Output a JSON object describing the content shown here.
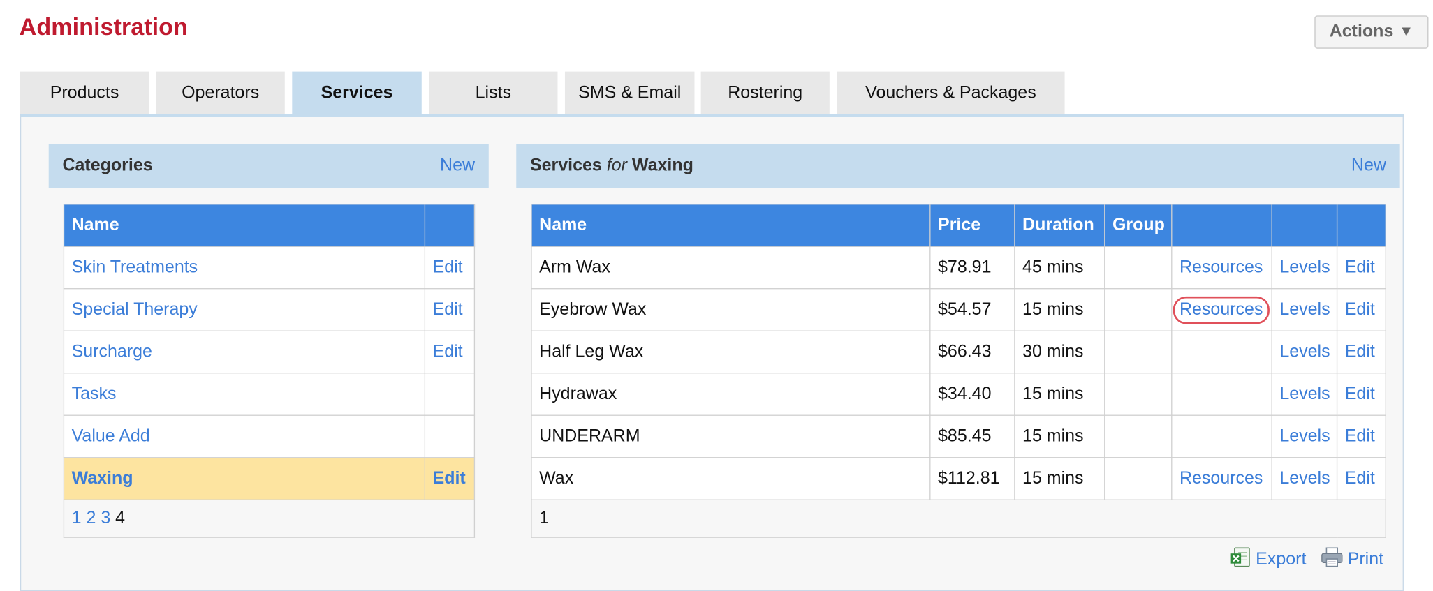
{
  "page_title": "Administration",
  "actions": {
    "label": "Actions",
    "arrow": "▼"
  },
  "tabs": [
    {
      "label": "Products",
      "active": false
    },
    {
      "label": "Operators",
      "active": false
    },
    {
      "label": "Services",
      "active": true
    },
    {
      "label": "Lists",
      "active": false
    },
    {
      "label": "SMS & Email",
      "active": false
    },
    {
      "label": "Rostering",
      "active": false
    },
    {
      "label": "Vouchers & Packages",
      "active": false
    }
  ],
  "categories": {
    "title": "Categories",
    "new_label": "New",
    "header": {
      "name": "Name",
      "action": ""
    },
    "rows": [
      {
        "name": "Skin Treatments",
        "edit": "Edit"
      },
      {
        "name": "Special Therapy",
        "edit": "Edit"
      },
      {
        "name": "Surcharge",
        "edit": "Edit"
      },
      {
        "name": "Tasks",
        "edit": ""
      },
      {
        "name": "Value Add",
        "edit": ""
      },
      {
        "name": "Waxing",
        "edit": "Edit",
        "selected": true
      }
    ],
    "pages": [
      "1",
      "2",
      "3"
    ],
    "current_page": "4"
  },
  "services": {
    "title_prefix": "Services",
    "title_for": "for",
    "title_category": "Waxing",
    "new_label": "New",
    "header": {
      "name": "Name",
      "price": "Price",
      "duration": "Duration",
      "group": "Group"
    },
    "rows": [
      {
        "name": "Arm Wax",
        "price": "$78.91",
        "duration": "45 mins",
        "group": "",
        "resources": "Resources",
        "levels": "Levels",
        "edit": "Edit"
      },
      {
        "name": "Eyebrow Wax",
        "price": "$54.57",
        "duration": "15 mins",
        "group": "",
        "resources": "Resources",
        "levels": "Levels",
        "edit": "Edit",
        "highlight_resources": true
      },
      {
        "name": "Half Leg Wax",
        "price": "$66.43",
        "duration": "30 mins",
        "group": "",
        "resources": "",
        "levels": "Levels",
        "edit": "Edit"
      },
      {
        "name": "Hydrawax",
        "price": "$34.40",
        "duration": "15 mins",
        "group": "",
        "resources": "",
        "levels": "Levels",
        "edit": "Edit"
      },
      {
        "name": "UNDERARM",
        "price": "$85.45",
        "duration": "15 mins",
        "group": "",
        "resources": "",
        "levels": "Levels",
        "edit": "Edit"
      },
      {
        "name": "Wax",
        "price": "$112.81",
        "duration": "15 mins",
        "group": "",
        "resources": "Resources",
        "levels": "Levels",
        "edit": "Edit"
      }
    ],
    "page": "1"
  },
  "footer": {
    "export_label": "Export",
    "print_label": "Print"
  },
  "colors": {
    "title": "#bf1a2f",
    "header_bg": "#3d86e0",
    "panel_bg": "#c5dcee",
    "link": "#3b7dd8",
    "selected_row": "#fde4a0",
    "highlight_ring": "#e0505a"
  },
  "icons": {
    "export": "excel-export-icon",
    "print": "printer-icon",
    "actions_arrow": "triangle-down-icon"
  }
}
